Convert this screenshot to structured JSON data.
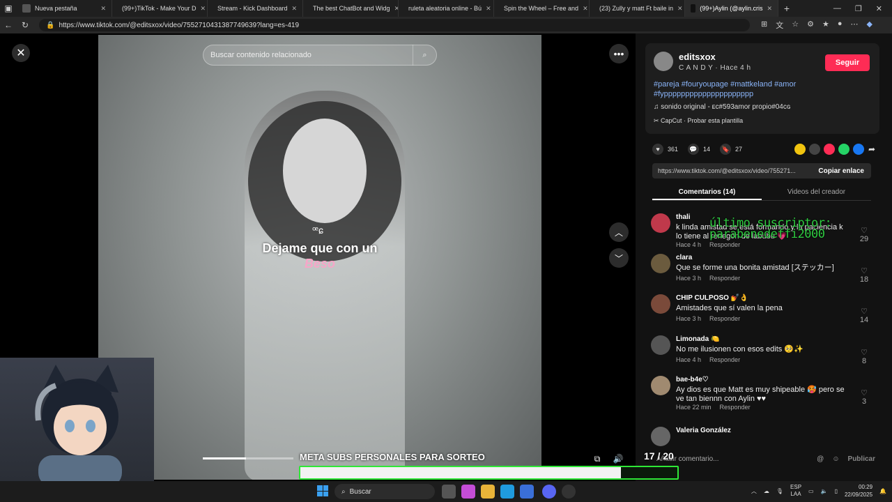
{
  "browser": {
    "tabs": [
      {
        "label": "Nueva pestaña",
        "color": "#555555"
      },
      {
        "label": "(99+)TikTok - Make Your D",
        "color": "#111111"
      },
      {
        "label": "Stream - Kick Dashboard",
        "color": "#53fc18"
      },
      {
        "label": "The best ChatBot and Widg",
        "color": "#ffffff"
      },
      {
        "label": "ruleta aleatoria online - Bú",
        "color": "#4a90e2"
      },
      {
        "label": "Spin the Wheel – Free and",
        "color": "#e84393"
      },
      {
        "label": "(23) Zully y matt Ft baile in",
        "color": "#ff0000"
      },
      {
        "label": "(99+)Aylin (@aylin.cris",
        "color": "#111111"
      }
    ],
    "new_tab": "+",
    "url": "https://www.tiktok.com/@editsxox/video/7552710431387749639?lang=es-419"
  },
  "video": {
    "search_placeholder": "Buscar contenido relacionado",
    "lyric_small": "ꟹɕ",
    "lyric_main": "Dejame que con un",
    "lyric_beso": "Beso",
    "progress": 0.48
  },
  "author": {
    "name": "editsxox",
    "subtitle": "C A N D Y · Hace 4 h",
    "follow_label": "Seguir",
    "hashtags": "#pareja #fouryoupage #mattkeland #amor #fyppppppppppppppppppppp",
    "sound": "sonido original - ᴇᴄ#593amor propio#04ᴄɢ",
    "capcut": "CapCut · Probar esta plantilla"
  },
  "actions": {
    "likes": "361",
    "comments": "14",
    "saves": "27",
    "share_colors": [
      "#f1c40f",
      "#444444",
      "#fe2c55",
      "#25d366",
      "#1877f2"
    ]
  },
  "link": {
    "url": "https://www.tiktok.com/@editsxox/video/755271...",
    "copy_label": "Copiar enlace"
  },
  "panel_tabs": {
    "comments": "Comentarios (14)",
    "creator_videos": "Videos del creador"
  },
  "comments": [
    {
      "user": "thali",
      "text": "k linda amistad se está formando y la paciencia k lo tiene al renegón de labubu 💗",
      "time": "Hace 4 h",
      "reply": "Responder",
      "likes": "29",
      "avatar": "#c0394b"
    },
    {
      "user": "clara",
      "text": "Que se forme una bonita amistad [ステッカー]",
      "time": "Hace 3 h",
      "reply": "Responder",
      "likes": "18",
      "avatar": "#6b5b3e"
    },
    {
      "user": "CHIP CULPOSO 💅👌",
      "text": "Amistades que sí valen la pena",
      "time": "Hace 3 h",
      "reply": "Responder",
      "likes": "14",
      "avatar": "#7a4a3a"
    },
    {
      "user": "Limonada 🍋",
      "text": "No me ilusionen con esos edits 🥺✨",
      "time": "Hace 4 h",
      "reply": "Responder",
      "likes": "8",
      "avatar": "#555555"
    },
    {
      "user": "bae-b4e♡",
      "text": "Ay dios es que Matt es muy shipeable 🥵 pero se ve tan biennn con Aylin ♥♥",
      "time": "Hace 22 min",
      "reply": "Responder",
      "likes": "3",
      "avatar": "#a08a70"
    },
    {
      "user": "Valeria González",
      "text": "",
      "time": "",
      "reply": "",
      "likes": "",
      "avatar": "#666666"
    }
  ],
  "stream_overlay": {
    "last_sub_line1": "último suscriptor:",
    "last_sub_line2": "parabenedeffi2000",
    "meta_title": "META SUBS PERSONALES PARA SORTEO",
    "meta_progress": 0.85,
    "counter": "17 / 20"
  },
  "comment_box": {
    "placeholder": "Añadir comentario...",
    "publish": "Publicar"
  },
  "taskbar": {
    "search": "Buscar",
    "lang_top": "ESP",
    "lang_bottom": "LAA",
    "time": "00:29",
    "date": "22/09/2025"
  }
}
